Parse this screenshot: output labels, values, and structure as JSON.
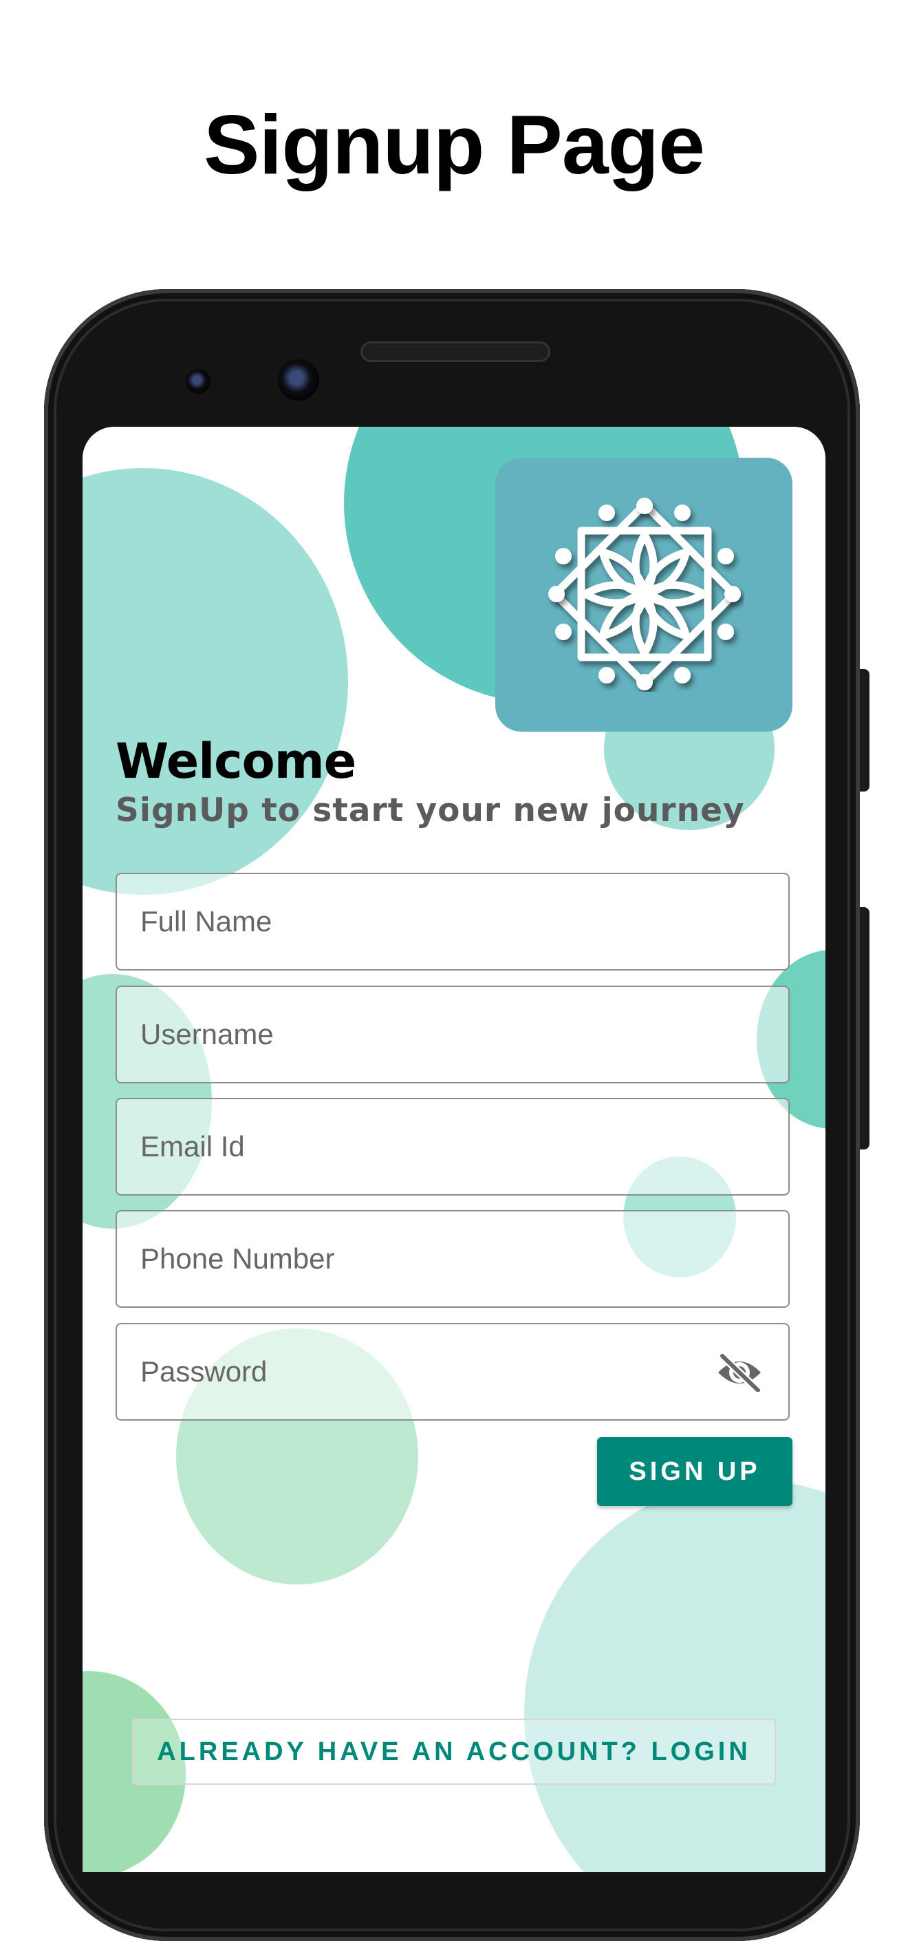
{
  "page": {
    "title": "Signup Page"
  },
  "screen": {
    "welcome": "Welcome",
    "subtitle": "SignUp to start your new journey",
    "fields": {
      "full_name": {
        "placeholder": "Full Name",
        "value": ""
      },
      "username": {
        "placeholder": "Username",
        "value": ""
      },
      "email": {
        "placeholder": "Email Id",
        "value": ""
      },
      "phone": {
        "placeholder": "Phone Number",
        "value": ""
      },
      "password": {
        "placeholder": "Password",
        "value": ""
      }
    },
    "signup_label": "SIGN UP",
    "login_label": "ALREADY HAVE AN ACCOUNT? LOGIN",
    "icons": {
      "logo": "mandala-flower-icon",
      "password_toggle": "eye-off-icon"
    }
  },
  "colors": {
    "primary": "#00897b",
    "logo_tile": "#64b2bf",
    "bubble_teal": "#5ec8bf",
    "bubble_light_teal": "#9fdfd6",
    "bubble_green": "#bce9d0",
    "bubble_pale": "#c9ece7",
    "subtitle": "#5b5b5b"
  }
}
